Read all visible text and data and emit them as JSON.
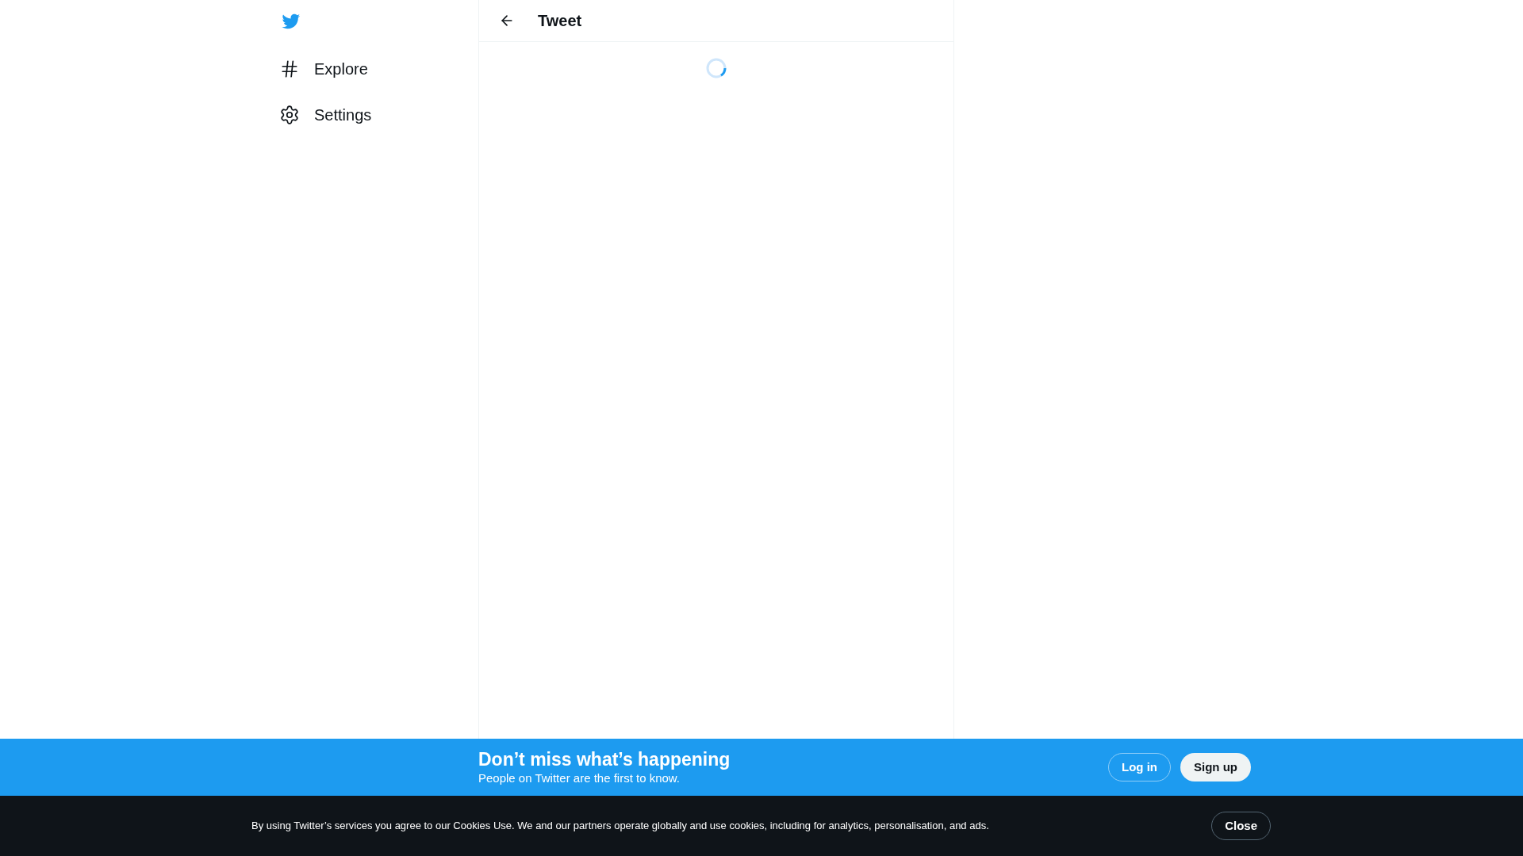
{
  "nav": {
    "items": [
      {
        "kind": "explore",
        "label": "Explore"
      },
      {
        "kind": "settings",
        "label": "Settings"
      }
    ]
  },
  "header": {
    "title": "Tweet"
  },
  "signup_bar": {
    "title": "Don’t miss what’s happening",
    "subtitle": "People on Twitter are the first to know.",
    "buttons": [
      {
        "kind": "outline",
        "label": "Log in"
      },
      {
        "kind": "filled",
        "label": "Sign up"
      }
    ]
  },
  "cookie_bar": {
    "text": "By using Twitter’s services you agree to our Cookies Use. We and our partners operate globally and use cookies, including for analytics, personalisation, and ads.",
    "button": "Close"
  }
}
